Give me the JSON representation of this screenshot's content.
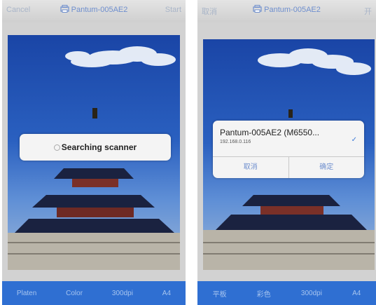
{
  "left_screen": {
    "topbar": {
      "left": "Cancel",
      "title": "Pantum-005AE2",
      "right": "Start"
    },
    "dialog": {
      "text": "Searching scanner"
    },
    "bottombar": [
      "Platen",
      "Color",
      "300dpi",
      "A4"
    ]
  },
  "right_screen": {
    "topbar": {
      "left": "取消",
      "title": "Pantum-005AE2",
      "right": "开"
    },
    "dialog": {
      "printer_name": "Pantum-005AE2 (M6550...",
      "ip": "192.168.0.116",
      "cancel": "取消",
      "confirm": "确定"
    },
    "bottombar": [
      "平板",
      "彩色",
      "300dpi",
      "A4"
    ]
  },
  "colors": {
    "accent_blue": "#2f6fd2",
    "title_blue": "#6f8fce"
  },
  "icons": [
    "printer-icon",
    "checkmark-icon",
    "spinner-icon"
  ]
}
